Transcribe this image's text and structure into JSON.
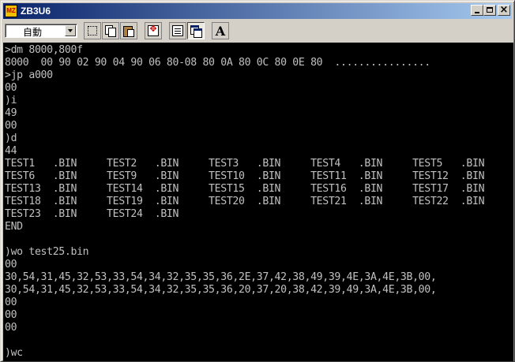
{
  "window": {
    "title": "ZB3U6",
    "app_icon_text": "MZ"
  },
  "toolbar": {
    "font_select_value": "自動",
    "font_button_label": "A",
    "buttons": [
      "select-icon",
      "copy-icon",
      "paste-icon",
      "move-icon",
      "properties-icon",
      "window-icon",
      "font-icon"
    ]
  },
  "colors": {
    "titlebar_start": "#0a246a",
    "titlebar_end": "#a6caf0",
    "console_bg": "#000000",
    "console_text": "#c0c0c0"
  },
  "console": {
    "lines": [
      ">dm 8000,800f",
      "8000  00 90 02 90 04 90 06 80-08 80 0A 80 0C 80 0E 80  ................",
      ">jp a000",
      "00",
      ")i",
      "49",
      "00",
      ")d",
      "44",
      "TEST1   .BIN     TEST2   .BIN     TEST3   .BIN     TEST4   .BIN     TEST5   .BIN",
      "TEST6   .BIN     TEST9   .BIN     TEST10  .BIN     TEST11  .BIN     TEST12  .BIN",
      "TEST13  .BIN     TEST14  .BIN     TEST15  .BIN     TEST16  .BIN     TEST17  .BIN",
      "TEST18  .BIN     TEST19  .BIN     TEST20  .BIN     TEST21  .BIN     TEST22  .BIN",
      "TEST23  .BIN     TEST24  .BIN",
      "END",
      "",
      ")wo test25.bin",
      "00",
      "30,54,31,45,32,53,33,54,34,32,35,35,36,2E,37,42,38,49,39,4E,3A,4E,3B,00,",
      "30,54,31,45,32,53,33,54,34,32,35,35,36,20,37,20,38,42,39,49,3A,4E,3B,00,",
      "00",
      "00",
      "00",
      "",
      ")wc"
    ]
  }
}
